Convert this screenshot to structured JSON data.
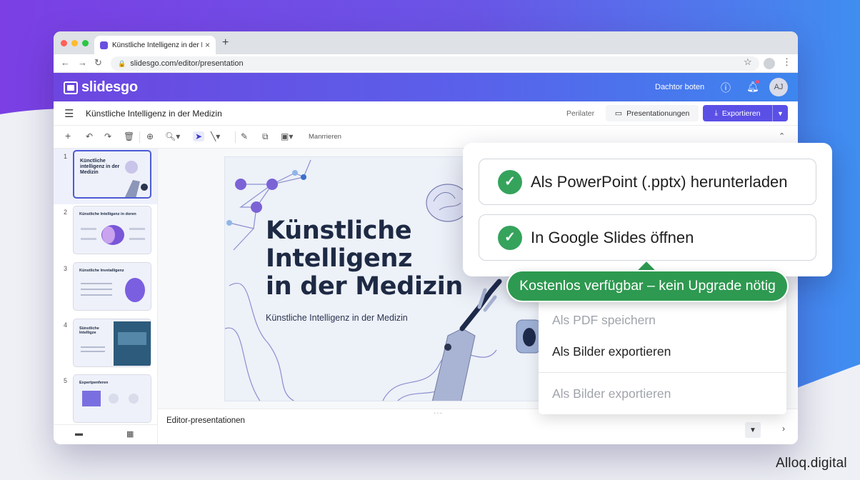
{
  "browser": {
    "tab_title": "Künstliche Intelligenz in der Medizin",
    "tab_close": "×",
    "new_tab": "+",
    "url": "slidesgo.com/editor/presentation"
  },
  "app_header": {
    "logo_text": "slidesgo",
    "link_text": "Dachtor boten",
    "avatar_initials": "AJ"
  },
  "title_bar": {
    "document_title": "Künstliche Intelligenz in der Medizin",
    "link_text": "Perilater",
    "present_label": "Presentationungen",
    "export_label": "Exportieren"
  },
  "toolbar": {
    "text_label": "Manrrieren"
  },
  "slides": [
    {
      "number": "1",
      "title": "Künctliche intelligenz in der Medizin"
    },
    {
      "number": "2",
      "title": "Künstliche Intelligenz in doren"
    },
    {
      "number": "3",
      "title": "Künstliche Invetalligenz"
    },
    {
      "number": "4",
      "title": "Sünstliche Intelligze"
    },
    {
      "number": "5",
      "title": "Expertpenferen"
    }
  ],
  "main_slide": {
    "title_line1": "Künstliche",
    "title_line2": "Intelligenz",
    "title_line3": "in der Medizin",
    "subtitle": "Künstliche Intelligenz in der Medizin"
  },
  "notes": {
    "label": "Editor-presentationen"
  },
  "export_popup": {
    "option_1": "Als PowerPoint (.pptx) herunterladen",
    "option_2": "In Google Slides öffnen",
    "badge": "Kostenlos verfügbar – kein Upgrade nötig"
  },
  "export_menu": {
    "item_pdf": "Als PDF speichern",
    "item_images": "Als Bilder exportieren",
    "item_images_disabled": "Als Bilder exportieren"
  },
  "watermark": "Alloq.digital",
  "colors": {
    "brand_gradient_start": "#6d46e0",
    "brand_gradient_end": "#3d86ef",
    "export_button": "#5b50e6",
    "success_green": "#2e9950",
    "check_green": "#35a35c"
  }
}
